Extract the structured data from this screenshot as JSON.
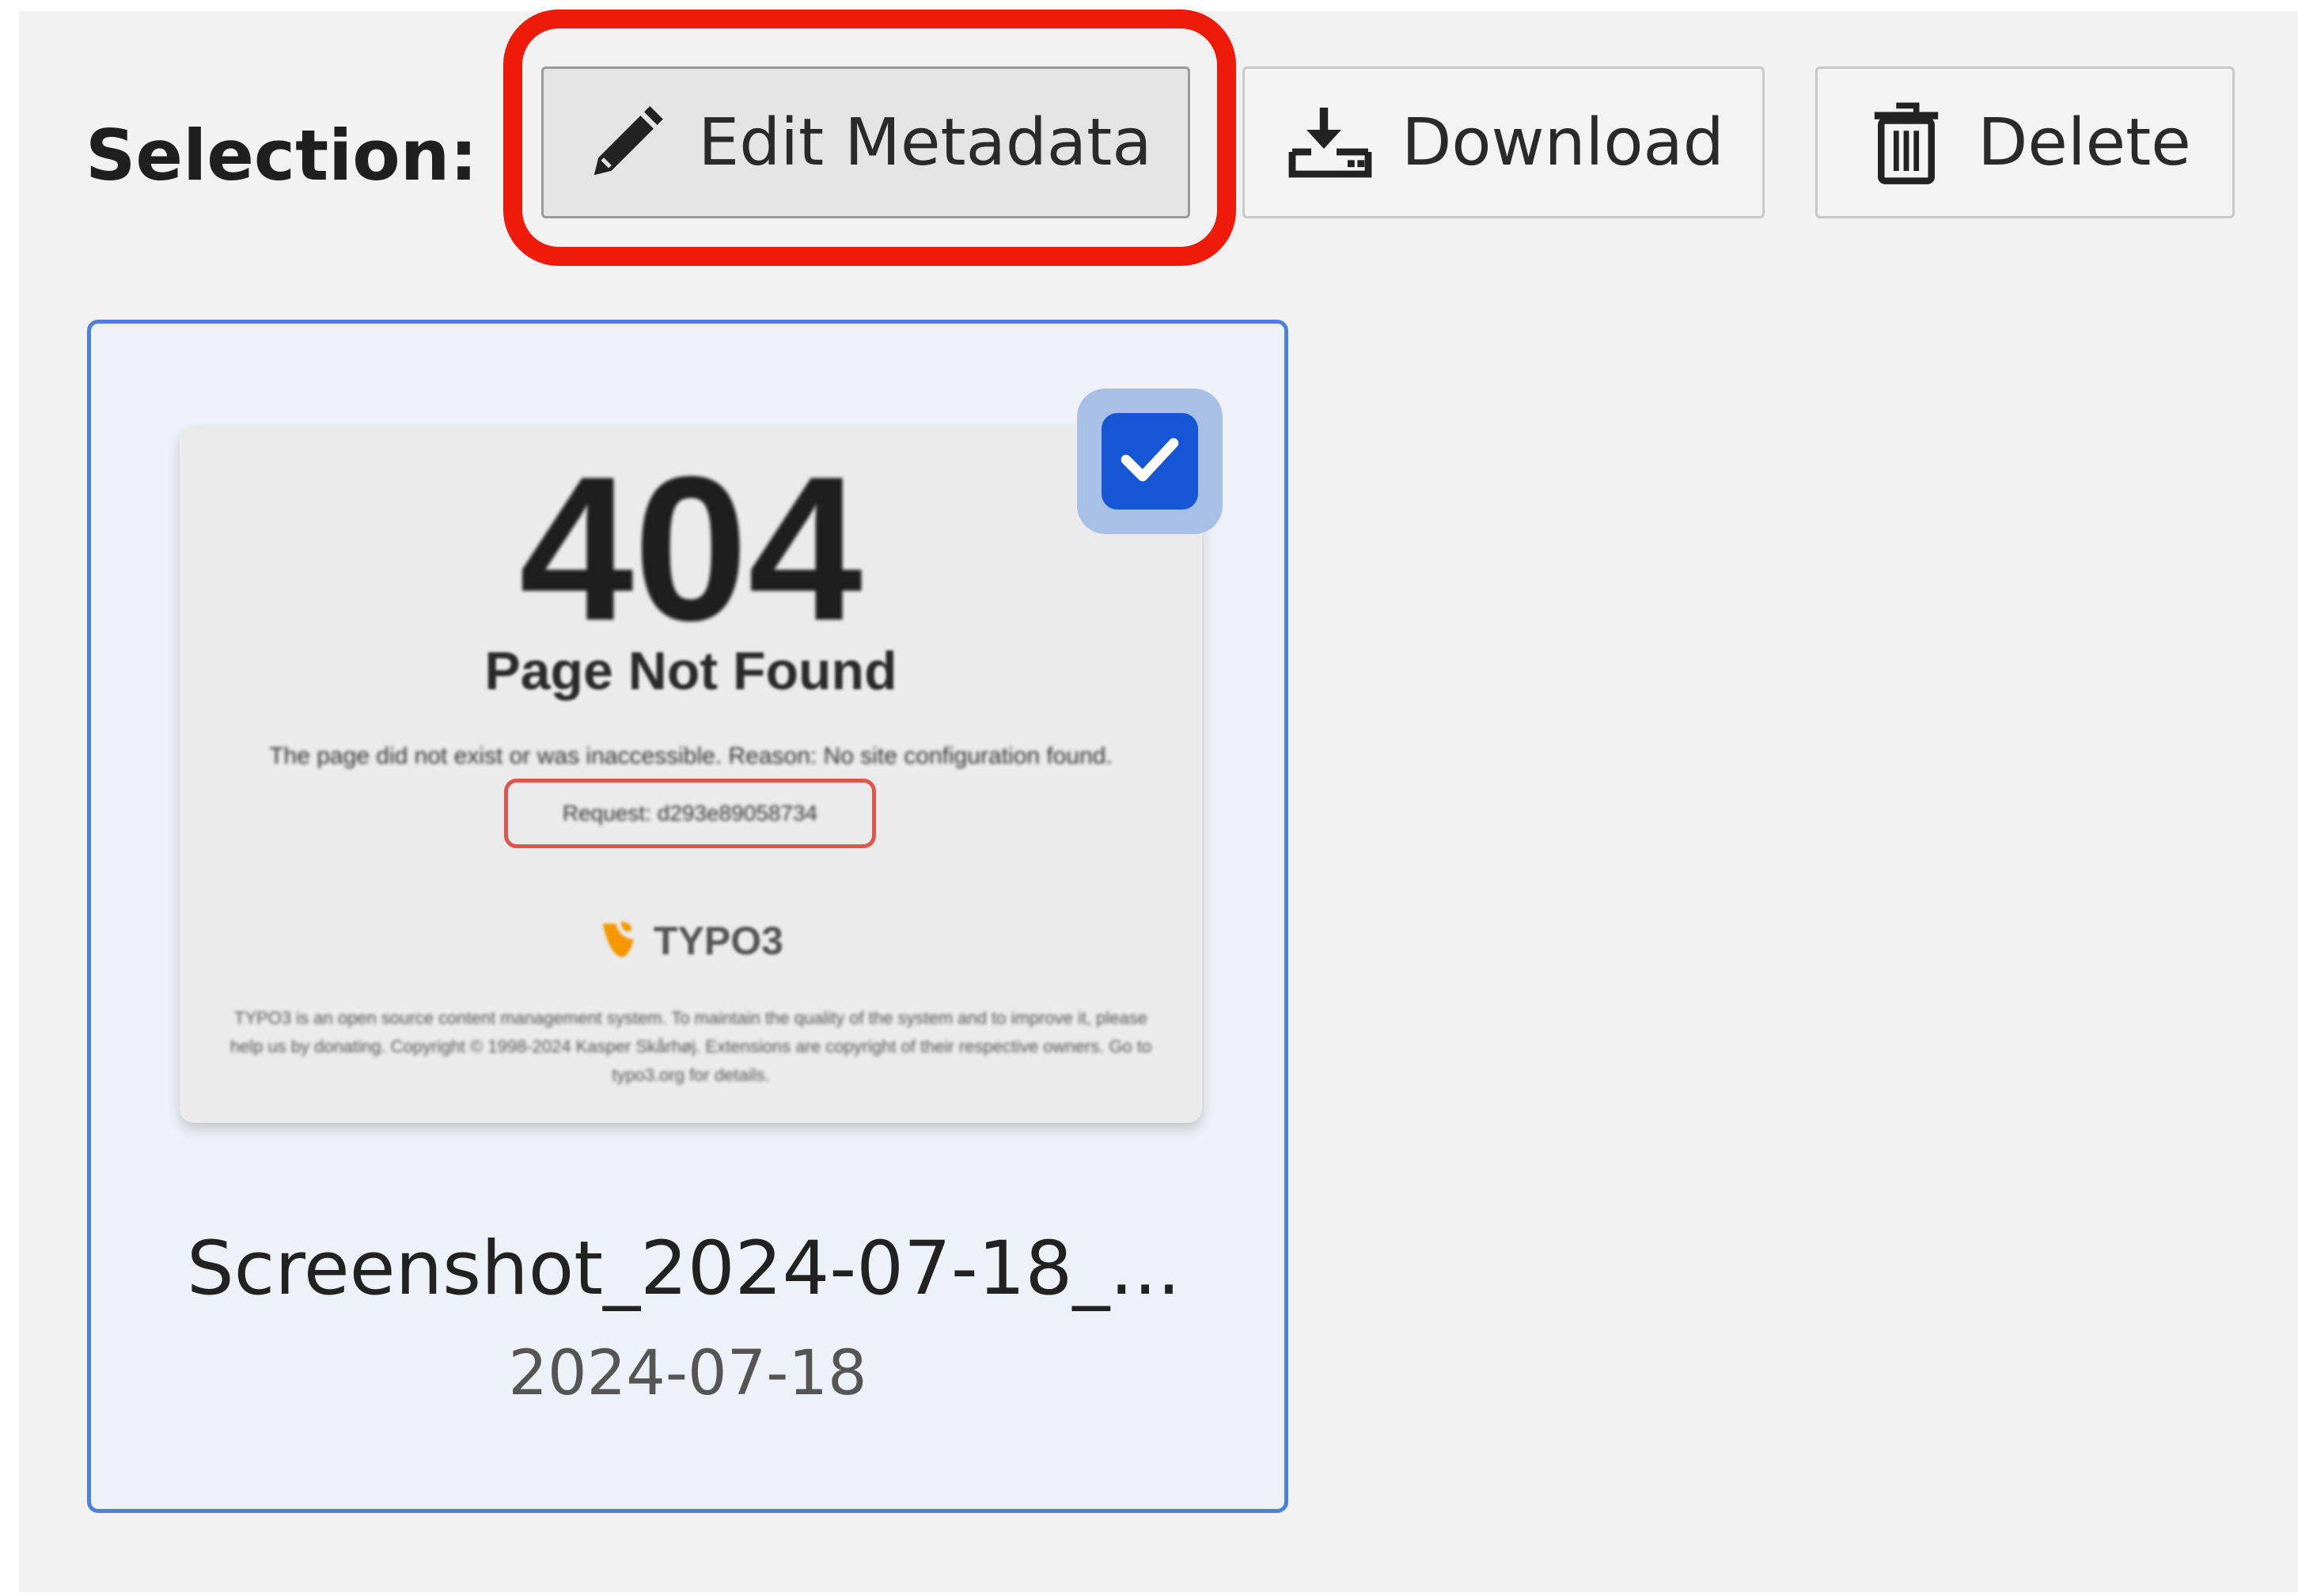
{
  "toolbar": {
    "label": "Selection:",
    "edit_label": "Edit Metadata",
    "download_label": "Download",
    "delete_label": "Delete",
    "highlight_color": "#ee1b0a"
  },
  "file_card": {
    "name": "Screenshot_2024-07-18_...",
    "date": "2024-07-18",
    "selected": true,
    "thumbnail": {
      "code": "404",
      "title": "Page Not Found",
      "message": "The page did not exist or was inaccessible. Reason: No site configuration found.",
      "request": "Request: d293e89058734",
      "brand": "TYPO3",
      "footer": "TYPO3 is an open source content management system. To maintain the quality of the system and to improve it, please help us by donating. Copyright © 1998-2024 Kasper Skårhøj. Extensions are copyright of their respective owners. Go to typo3.org for details."
    }
  },
  "icons": {
    "edit": "pencil-icon",
    "download": "download-icon",
    "delete": "trash-icon",
    "checkbox": "checkmark-icon"
  },
  "colors": {
    "accent": "#1456d4",
    "card_border": "#4f7fdc",
    "card_bg": "#eef2f8"
  }
}
